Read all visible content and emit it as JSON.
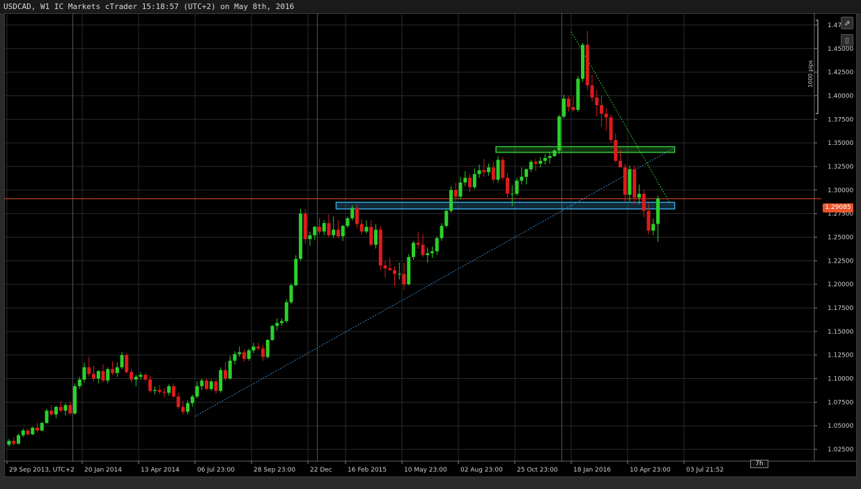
{
  "window": {
    "title": "USDCAD, W1 IC Markets cTrader 15:18:57 (UTC+2) on May 8th, 2016"
  },
  "toolbar": {
    "popout_icon": "⇗",
    "camera_icon": "⌷"
  },
  "current_price": {
    "label": "1.29085",
    "value": 1.29085,
    "color": "#e8542a"
  },
  "timeframe_badge": "7h",
  "ruler": {
    "label": "1000 pips"
  },
  "colors": {
    "bull": "#2bd12b",
    "bear": "#dd1c1c",
    "grid": "#2b2b2b",
    "axis_text": "#cfcfcf",
    "trend": "#3a8fd8",
    "zone_blue": "#3aa6e0",
    "zone_green": "#38c838",
    "price_line": "#e8542a"
  },
  "chart_data": {
    "type": "candlestick",
    "symbol": "USDCAD",
    "timeframe": "W1",
    "ylim": [
      1.0125,
      1.4875
    ],
    "y_ticks": [
      "1.02500",
      "1.05000",
      "1.07500",
      "1.10000",
      "1.12500",
      "1.15000",
      "1.17500",
      "1.20000",
      "1.22500",
      "1.25000",
      "1.27500",
      "1.30000",
      "1.32500",
      "1.35000",
      "1.37500",
      "1.40000",
      "1.42500",
      "1.45000",
      "1.47500"
    ],
    "x_labels": [
      {
        "label": "29 Sep 2013, UTC+2",
        "index": 0
      },
      {
        "label": "20 Jan 2014",
        "index": 16
      },
      {
        "label": "13 Apr 2014",
        "index": 28
      },
      {
        "label": "06 Jul 23:00",
        "index": 40
      },
      {
        "label": "28 Sep 23:00",
        "index": 52
      },
      {
        "label": "22 Dec",
        "index": 64
      },
      {
        "label": "16 Feb 2015",
        "index": 72
      },
      {
        "label": "10 May 23:00",
        "index": 84
      },
      {
        "label": "02 Aug 23:00",
        "index": 96
      },
      {
        "label": "25 Oct 23:00",
        "index": 108
      },
      {
        "label": "18 Jan 2016",
        "index": 120
      },
      {
        "label": "10 Apr 23:00",
        "index": 132
      },
      {
        "label": "03 Jul 21:52",
        "index": 144
      }
    ],
    "separators": [
      14,
      66,
      118
    ],
    "candles": [
      [
        1.03,
        1.036,
        1.028,
        1.034
      ],
      [
        1.034,
        1.038,
        1.029,
        1.031
      ],
      [
        1.031,
        1.042,
        1.03,
        1.04
      ],
      [
        1.04,
        1.047,
        1.038,
        1.045
      ],
      [
        1.045,
        1.047,
        1.039,
        1.041
      ],
      [
        1.041,
        1.049,
        1.04,
        1.048
      ],
      [
        1.048,
        1.053,
        1.043,
        1.045
      ],
      [
        1.045,
        1.054,
        1.044,
        1.053
      ],
      [
        1.053,
        1.068,
        1.052,
        1.066
      ],
      [
        1.066,
        1.072,
        1.06,
        1.062
      ],
      [
        1.062,
        1.071,
        1.058,
        1.07
      ],
      [
        1.07,
        1.076,
        1.064,
        1.066
      ],
      [
        1.066,
        1.074,
        1.061,
        1.072
      ],
      [
        1.072,
        1.076,
        1.062,
        1.063
      ],
      [
        1.063,
        1.095,
        1.062,
        1.092
      ],
      [
        1.092,
        1.102,
        1.089,
        1.099
      ],
      [
        1.099,
        1.117,
        1.096,
        1.112
      ],
      [
        1.112,
        1.123,
        1.102,
        1.105
      ],
      [
        1.105,
        1.114,
        1.097,
        1.1
      ],
      [
        1.1,
        1.109,
        1.095,
        1.108
      ],
      [
        1.108,
        1.115,
        1.096,
        1.098
      ],
      [
        1.098,
        1.112,
        1.095,
        1.11
      ],
      [
        1.11,
        1.118,
        1.104,
        1.106
      ],
      [
        1.106,
        1.117,
        1.102,
        1.112
      ],
      [
        1.112,
        1.128,
        1.11,
        1.125
      ],
      [
        1.125,
        1.127,
        1.105,
        1.107
      ],
      [
        1.107,
        1.11,
        1.096,
        1.099
      ],
      [
        1.099,
        1.104,
        1.092,
        1.102
      ],
      [
        1.102,
        1.107,
        1.099,
        1.104
      ],
      [
        1.104,
        1.106,
        1.097,
        1.099
      ],
      [
        1.099,
        1.103,
        1.085,
        1.087
      ],
      [
        1.087,
        1.092,
        1.083,
        1.088
      ],
      [
        1.088,
        1.093,
        1.084,
        1.086
      ],
      [
        1.086,
        1.09,
        1.08,
        1.085
      ],
      [
        1.085,
        1.094,
        1.082,
        1.092
      ],
      [
        1.092,
        1.095,
        1.08,
        1.081
      ],
      [
        1.081,
        1.085,
        1.068,
        1.07
      ],
      [
        1.07,
        1.076,
        1.062,
        1.065
      ],
      [
        1.065,
        1.077,
        1.062,
        1.074
      ],
      [
        1.074,
        1.083,
        1.07,
        1.081
      ],
      [
        1.081,
        1.097,
        1.079,
        1.092
      ],
      [
        1.092,
        1.1,
        1.088,
        1.098
      ],
      [
        1.098,
        1.1,
        1.088,
        1.089
      ],
      [
        1.089,
        1.099,
        1.087,
        1.097
      ],
      [
        1.097,
        1.099,
        1.084,
        1.087
      ],
      [
        1.087,
        1.112,
        1.085,
        1.109
      ],
      [
        1.109,
        1.118,
        1.098,
        1.1
      ],
      [
        1.1,
        1.124,
        1.099,
        1.119
      ],
      [
        1.119,
        1.129,
        1.115,
        1.126
      ],
      [
        1.126,
        1.134,
        1.123,
        1.128
      ],
      [
        1.128,
        1.131,
        1.118,
        1.121
      ],
      [
        1.121,
        1.132,
        1.119,
        1.13
      ],
      [
        1.13,
        1.138,
        1.127,
        1.134
      ],
      [
        1.134,
        1.138,
        1.13,
        1.132
      ],
      [
        1.132,
        1.136,
        1.119,
        1.123
      ],
      [
        1.123,
        1.142,
        1.121,
        1.141
      ],
      [
        1.141,
        1.157,
        1.14,
        1.156
      ],
      [
        1.156,
        1.164,
        1.151,
        1.159
      ],
      [
        1.159,
        1.164,
        1.156,
        1.161
      ],
      [
        1.161,
        1.184,
        1.159,
        1.181
      ],
      [
        1.181,
        1.201,
        1.179,
        1.199
      ],
      [
        1.199,
        1.231,
        1.198,
        1.227
      ],
      [
        1.227,
        1.28,
        1.225,
        1.275
      ],
      [
        1.275,
        1.28,
        1.243,
        1.248
      ],
      [
        1.248,
        1.256,
        1.241,
        1.252
      ],
      [
        1.252,
        1.262,
        1.247,
        1.261
      ],
      [
        1.261,
        1.27,
        1.253,
        1.256
      ],
      [
        1.256,
        1.268,
        1.252,
        1.265
      ],
      [
        1.265,
        1.274,
        1.25,
        1.252
      ],
      [
        1.252,
        1.272,
        1.249,
        1.258
      ],
      [
        1.258,
        1.268,
        1.249,
        1.251
      ],
      [
        1.251,
        1.263,
        1.246,
        1.262
      ],
      [
        1.262,
        1.272,
        1.26,
        1.27
      ],
      [
        1.27,
        1.284,
        1.268,
        1.281
      ],
      [
        1.281,
        1.285,
        1.26,
        1.264
      ],
      [
        1.264,
        1.269,
        1.253,
        1.256
      ],
      [
        1.256,
        1.268,
        1.254,
        1.261
      ],
      [
        1.261,
        1.268,
        1.24,
        1.242
      ],
      [
        1.242,
        1.264,
        1.238,
        1.258
      ],
      [
        1.258,
        1.262,
        1.215,
        1.22
      ],
      [
        1.22,
        1.225,
        1.207,
        1.217
      ],
      [
        1.217,
        1.228,
        1.215,
        1.215
      ],
      [
        1.215,
        1.219,
        1.198,
        1.211
      ],
      [
        1.211,
        1.223,
        1.205,
        1.211
      ],
      [
        1.211,
        1.223,
        1.194,
        1.2
      ],
      [
        1.2,
        1.232,
        1.199,
        1.229
      ],
      [
        1.229,
        1.246,
        1.226,
        1.244
      ],
      [
        1.244,
        1.256,
        1.238,
        1.242
      ],
      [
        1.242,
        1.253,
        1.229,
        1.231
      ],
      [
        1.231,
        1.239,
        1.223,
        1.233
      ],
      [
        1.233,
        1.24,
        1.228,
        1.235
      ],
      [
        1.235,
        1.251,
        1.231,
        1.249
      ],
      [
        1.249,
        1.265,
        1.246,
        1.262
      ],
      [
        1.262,
        1.28,
        1.26,
        1.278
      ],
      [
        1.278,
        1.304,
        1.276,
        1.3
      ],
      [
        1.3,
        1.308,
        1.288,
        1.293
      ],
      [
        1.293,
        1.314,
        1.29,
        1.308
      ],
      [
        1.308,
        1.32,
        1.304,
        1.313
      ],
      [
        1.313,
        1.317,
        1.298,
        1.303
      ],
      [
        1.303,
        1.323,
        1.301,
        1.317
      ],
      [
        1.317,
        1.327,
        1.313,
        1.321
      ],
      [
        1.321,
        1.333,
        1.314,
        1.319
      ],
      [
        1.319,
        1.328,
        1.315,
        1.324
      ],
      [
        1.324,
        1.33,
        1.308,
        1.311
      ],
      [
        1.311,
        1.336,
        1.308,
        1.332
      ],
      [
        1.332,
        1.335,
        1.31,
        1.313
      ],
      [
        1.313,
        1.318,
        1.292,
        1.296
      ],
      [
        1.296,
        1.305,
        1.283,
        1.296
      ],
      [
        1.296,
        1.313,
        1.294,
        1.31
      ],
      [
        1.31,
        1.324,
        1.306,
        1.314
      ],
      [
        1.314,
        1.323,
        1.306,
        1.322
      ],
      [
        1.322,
        1.332,
        1.319,
        1.33
      ],
      [
        1.33,
        1.333,
        1.32,
        1.328
      ],
      [
        1.328,
        1.335,
        1.324,
        1.331
      ],
      [
        1.331,
        1.338,
        1.327,
        1.334
      ],
      [
        1.334,
        1.34,
        1.328,
        1.336
      ],
      [
        1.336,
        1.343,
        1.335,
        1.342
      ],
      [
        1.342,
        1.38,
        1.338,
        1.378
      ],
      [
        1.378,
        1.401,
        1.376,
        1.397
      ],
      [
        1.397,
        1.4,
        1.383,
        1.388
      ],
      [
        1.388,
        1.399,
        1.383,
        1.385
      ],
      [
        1.385,
        1.421,
        1.383,
        1.418
      ],
      [
        1.418,
        1.456,
        1.415,
        1.454
      ],
      [
        1.454,
        1.469,
        1.406,
        1.411
      ],
      [
        1.411,
        1.422,
        1.394,
        1.398
      ],
      [
        1.398,
        1.406,
        1.378,
        1.39
      ],
      [
        1.39,
        1.4,
        1.367,
        1.381
      ],
      [
        1.381,
        1.387,
        1.363,
        1.377
      ],
      [
        1.377,
        1.38,
        1.35,
        1.353
      ],
      [
        1.353,
        1.36,
        1.329,
        1.331
      ],
      [
        1.331,
        1.343,
        1.325,
        1.324
      ],
      [
        1.324,
        1.328,
        1.288,
        1.295
      ],
      [
        1.295,
        1.326,
        1.288,
        1.322
      ],
      [
        1.322,
        1.326,
        1.285,
        1.292
      ],
      [
        1.292,
        1.306,
        1.285,
        1.296
      ],
      [
        1.296,
        1.3,
        1.271,
        1.278
      ],
      [
        1.278,
        1.286,
        1.253,
        1.257
      ],
      [
        1.257,
        1.27,
        1.252,
        1.264
      ],
      [
        1.264,
        1.294,
        1.245,
        1.291
      ]
    ],
    "trendline": {
      "style": "dotted",
      "from": {
        "index": 40,
        "price": 1.06
      },
      "to": {
        "index": 142,
        "price": 1.345
      }
    },
    "diagonal_line": {
      "style": "dotted",
      "from": {
        "index": 120,
        "price": 1.468
      },
      "to": {
        "index": 141,
        "price": 1.286
      }
    },
    "zones": [
      {
        "name": "support-zone",
        "color": "blue",
        "x_from": 70,
        "x_to": 142,
        "y_from": 1.28,
        "y_to": 1.287
      },
      {
        "name": "resistance-zone",
        "color": "green",
        "x_from": 104,
        "x_to": 142,
        "y_from": 1.34,
        "y_to": 1.346
      }
    ],
    "grid": true,
    "legend": "none"
  }
}
